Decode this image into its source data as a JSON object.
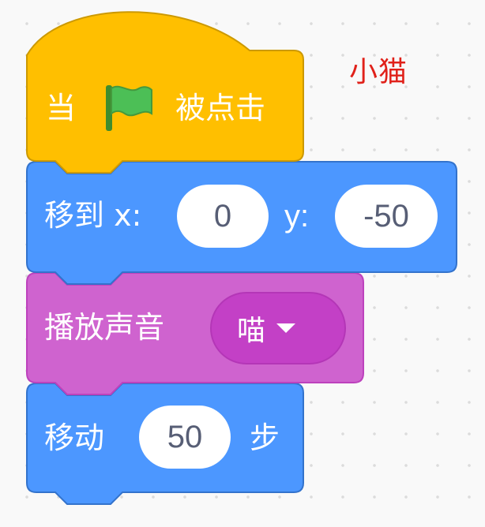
{
  "sprite_name": "小猫",
  "blocks": {
    "hat": {
      "when_label": "当",
      "flag_icon": "green-flag-icon",
      "clicked_label": "被点击",
      "color": "#ffbf00"
    },
    "goto": {
      "label": "移到 x:",
      "x_value": "0",
      "y_label": "y:",
      "y_value": "-50",
      "color": "#4c97ff"
    },
    "sound": {
      "label": "播放声音",
      "sound_value": "喵",
      "caret_icon": "dropdown-caret-icon",
      "color": "#cf63cf"
    },
    "move": {
      "label": "移动",
      "steps_value": "50",
      "steps_label": "步",
      "color": "#4c97ff"
    }
  }
}
